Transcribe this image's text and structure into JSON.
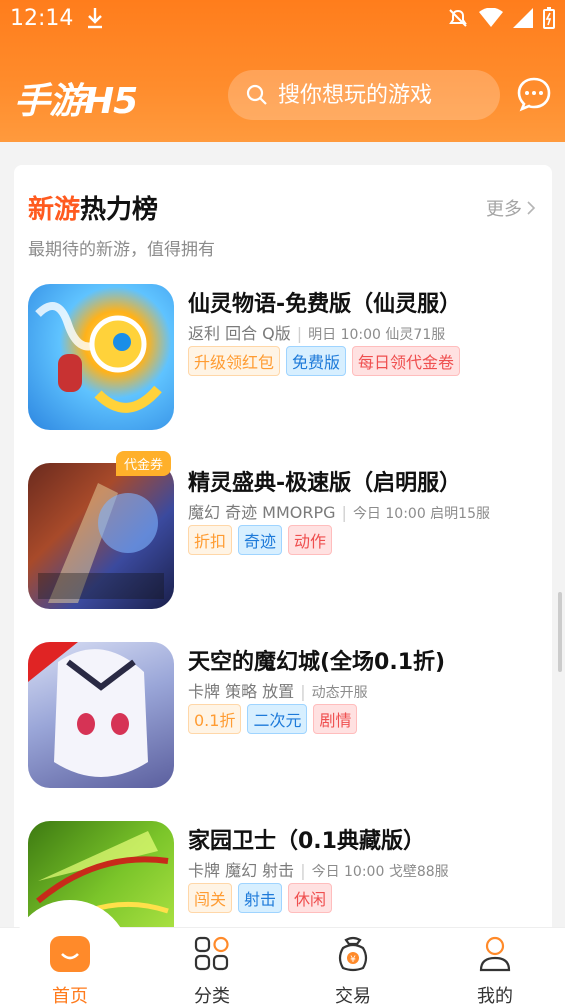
{
  "status_bar": {
    "time": "12:14"
  },
  "header": {
    "logo": "手游H5",
    "search_placeholder": "搜你想玩的游戏"
  },
  "section": {
    "title_highlight": "新游",
    "title_rest": "热力榜",
    "more": "更多",
    "subtitle": "最期待的新游，值得拥有"
  },
  "games": [
    {
      "name": "仙灵物语-免费版（仙灵服）",
      "genres": "返利  回合  Q版",
      "schedule": "明日 10:00 仙灵71服",
      "badge": "",
      "tags": [
        {
          "text": "升级领红包",
          "style": "orange"
        },
        {
          "text": "免费版",
          "style": "blue"
        },
        {
          "text": "每日领代金卷",
          "style": "red"
        }
      ]
    },
    {
      "name": "精灵盛典-极速版（启明服）",
      "genres": "魔幻  奇迹  MMORPG",
      "schedule": "今日 10:00 启明15服",
      "badge": "代金券",
      "tags": [
        {
          "text": "折扣",
          "style": "orange"
        },
        {
          "text": "奇迹",
          "style": "blue"
        },
        {
          "text": "动作",
          "style": "red"
        }
      ]
    },
    {
      "name": "天空的魔幻城(全场0.1折)",
      "genres": "卡牌  策略  放置",
      "schedule": "动态开服",
      "badge": "",
      "tags": [
        {
          "text": "0.1折",
          "style": "orange"
        },
        {
          "text": "二次元",
          "style": "blue"
        },
        {
          "text": "剧情",
          "style": "red"
        }
      ]
    },
    {
      "name": "家园卫士（0.1典藏版）",
      "genres": "卡牌  魔幻  射击",
      "schedule": "今日 10:00 戈壁88服",
      "badge": "",
      "tags": [
        {
          "text": "闯关",
          "style": "orange"
        },
        {
          "text": "射击",
          "style": "blue"
        },
        {
          "text": "休闲",
          "style": "red"
        }
      ]
    }
  ],
  "tabs": [
    {
      "label": "首页",
      "icon": "home-icon",
      "active": true
    },
    {
      "label": "分类",
      "icon": "category-icon",
      "active": false
    },
    {
      "label": "交易",
      "icon": "trade-icon",
      "active": false
    },
    {
      "label": "我的",
      "icon": "profile-icon",
      "active": false
    }
  ],
  "colors": {
    "accent": "#ff7b1c",
    "header": "#ff8a2a"
  }
}
